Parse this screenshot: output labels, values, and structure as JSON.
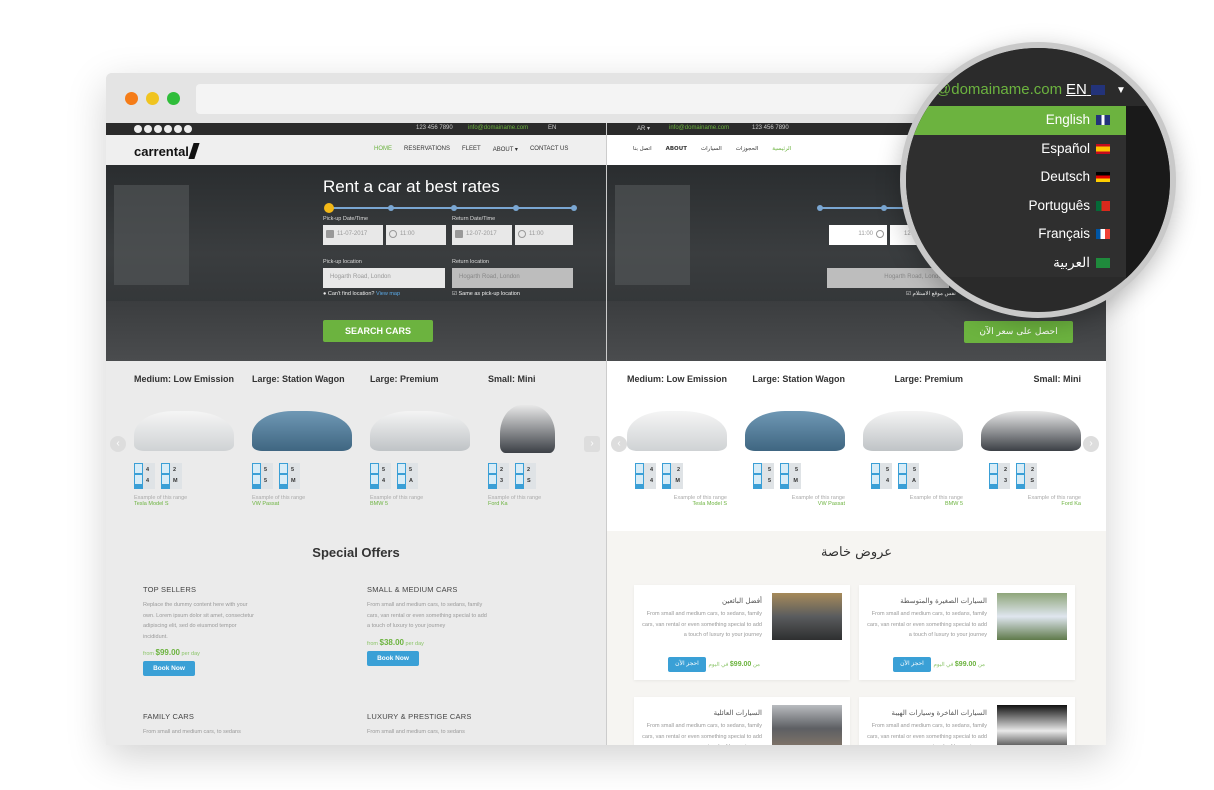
{
  "browser": {
    "traffic_lights": [
      "close",
      "minimize",
      "maximize"
    ]
  },
  "ltr_site": {
    "topbar": {
      "phone": "123 456 7890",
      "email": "info@domainame.com",
      "lang": "EN"
    },
    "logo": "carrental",
    "menu": [
      "HOME",
      "RESERVATIONS",
      "FLEET",
      "ABOUT ▾",
      "CONTACT US"
    ],
    "hero": {
      "title": "Rent a car at best rates",
      "pickup_label": "Pick-up Date/Time",
      "pickup_date": "11-07-2017",
      "pickup_time": "11:00",
      "return_label": "Return Date/Time",
      "return_date": "12-07-2017",
      "return_time": "11:00",
      "pickup_loc_label": "Pick-up location",
      "pickup_loc": "Hogarth Road, London",
      "return_loc_label": "Return location",
      "return_loc": "Hogarth Road, London",
      "cant_find": "Can't find location?",
      "view_map": "View map",
      "same_loc": "Same as pick-up location",
      "search_btn": "SEARCH CARS"
    },
    "fleet": [
      {
        "title": "Medium: Low Emission",
        "seats": "4",
        "doors": "4",
        "bags": "2",
        "trans": "M",
        "example": "Example of this range",
        "model": "Tesla Model S"
      },
      {
        "title": "Large: Station Wagon",
        "seats": "5",
        "doors": "5",
        "bags": "5",
        "trans": "M",
        "example": "Example of this range",
        "model": "VW Passat"
      },
      {
        "title": "Large: Premium",
        "seats": "5",
        "doors": "4",
        "bags": "5",
        "trans": "A",
        "example": "Example of this range",
        "model": "BMW 5"
      },
      {
        "title": "Small: Mini",
        "seats": "2",
        "doors": "3",
        "bags": "2",
        "trans": "S",
        "example": "Example of this range",
        "model": "Ford Ka"
      }
    ],
    "offers_title": "Special Offers",
    "offers": [
      {
        "title": "TOP SELLERS",
        "text": "Replace the dummy content here with your own. Lorem ipsum dolor sit amet, consectetur adipiscing elit, sed do eiusmod tempor incididunt.",
        "from": "from",
        "price": "$99.00",
        "per": "per day",
        "btn": "Book Now"
      },
      {
        "title": "SMALL & MEDIUM CARS",
        "text": "From small and medium cars, to sedans, family cars, van rental or even something special to add a touch of luxury to your journey",
        "from": "from",
        "price": "$38.00",
        "per": "per day",
        "btn": "Book Now"
      },
      {
        "title": "FAMILY CARS",
        "text": "From small and medium cars, to sedans"
      },
      {
        "title": "LUXURY & PRESTIGE CARS",
        "text": "From small and medium cars, to sedans"
      }
    ]
  },
  "rtl_site": {
    "topbar": {
      "lang": "AR ▾",
      "email": "info@domainame.com",
      "phone": "123 456 7890"
    },
    "menu": [
      "الرئيسية",
      "الحجوزات",
      "السيارات",
      "ABOUT",
      "اتصل بنا"
    ],
    "hero": {
      "time": "11:00",
      "date": "12-0",
      "loc": "Hogarth Road, London",
      "same_loc": "نفس موقع الاستلام",
      "search_btn": "احصل على سعر الآن"
    },
    "offers_title": "عروض خاصة",
    "offers": [
      {
        "title": "السيارات الصغيرة والمتوسطة",
        "text": "From small and medium cars, to sedans, family cars, van rental or even something special to add a touch of luxury to your journey",
        "price": "99.00$",
        "per": "في اليوم",
        "from": "من",
        "btn": "احجز الآن"
      },
      {
        "title": "أفضل البائعين",
        "text": "From small and medium cars, to sedans, family cars, van rental or even something special to add a touch of luxury to your journey",
        "price": "99.00$",
        "per": "في اليوم",
        "from": "من",
        "btn": "احجز الآن"
      },
      {
        "title": "السيارات الفاخرة وسيارات الهيبة",
        "text": "From small and medium cars, to sedans, family cars, van rental or even something special to add a touch of luxury to your"
      },
      {
        "title": "السيارات العائلية",
        "text": "From small and medium cars, to sedans, family cars, van rental or even something special to add a touch of luxury to your"
      }
    ]
  },
  "magnifier": {
    "email_partial": "@domainame.com",
    "current_lang": "EN",
    "languages": [
      {
        "label": "English",
        "flag": "uk-flag",
        "selected": true
      },
      {
        "label": "Español",
        "flag": "spain-flag",
        "selected": false
      },
      {
        "label": "Deutsch",
        "flag": "germany-flag",
        "selected": false
      },
      {
        "label": "Português",
        "flag": "portugal-flag",
        "selected": false
      },
      {
        "label": "Français",
        "flag": "france-flag",
        "selected": false
      },
      {
        "label": "العربية",
        "flag": "saudi-flag",
        "selected": false
      }
    ]
  },
  "colors": {
    "accent_green": "#6cb33f",
    "button_blue": "#3aa0d6",
    "dark_bar": "#2b2b2b"
  }
}
